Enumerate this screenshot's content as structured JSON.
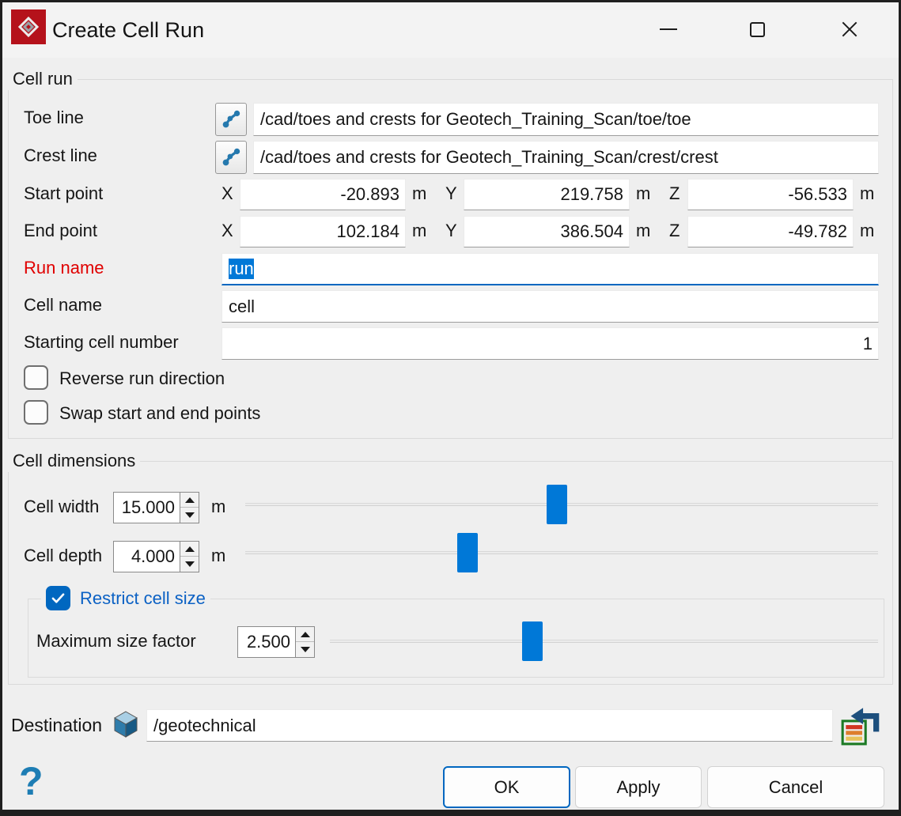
{
  "window": {
    "title": "Create Cell Run"
  },
  "icons": {
    "app_icon": "maptek-logo",
    "line_picker": "polyline",
    "destination_type": "cube",
    "destination_container": "container-with-arrow",
    "help": "question-mark"
  },
  "cell_run": {
    "group_label": "Cell run",
    "axis": {
      "x": "X",
      "y": "Y",
      "z": "Z"
    },
    "toe_line": {
      "label": "Toe line",
      "value": "/cad/toes and crests for Geotech_Training_Scan/toe/toe"
    },
    "crest_line": {
      "label": "Crest line",
      "value": "/cad/toes and crests for Geotech_Training_Scan/crest/crest"
    },
    "start_point": {
      "label": "Start point",
      "x": "-20.893",
      "y": "219.758",
      "z": "-56.533",
      "unit": "m"
    },
    "end_point": {
      "label": "End point",
      "x": "102.184",
      "y": "386.504",
      "z": "-49.782",
      "unit": "m"
    },
    "run_name": {
      "label": "Run name",
      "value": "run"
    },
    "cell_name": {
      "label": "Cell name",
      "value": "cell"
    },
    "starting_cell_number": {
      "label": "Starting cell number",
      "value": "1"
    },
    "reverse_run_direction": {
      "label": "Reverse run direction",
      "checked": false
    },
    "swap_start_end": {
      "label": "Swap start and end points",
      "checked": false
    }
  },
  "cell_dimensions": {
    "group_label": "Cell dimensions",
    "cell_width": {
      "label": "Cell width",
      "value": "15.000",
      "unit": "m"
    },
    "cell_depth": {
      "label": "Cell depth",
      "value": "4.000",
      "unit": "m"
    },
    "restrict_cell_size": {
      "label": "Restrict cell size",
      "checked": true
    },
    "maximum_size_factor": {
      "label": "Maximum size factor",
      "value": "2.500"
    }
  },
  "destination": {
    "label": "Destination",
    "value": "/geotechnical"
  },
  "footer": {
    "help_glyph": "?",
    "ok_label": "OK",
    "apply_label": "Apply",
    "cancel_label": "Cancel"
  },
  "colors": {
    "accent_blue": "#0078d7",
    "checkbox_blue": "#0067c0",
    "run_name_red": "#e00000",
    "restrict_label_blue": "#0b61c4",
    "logo_red": "#b5121b",
    "icon_blue": "#2579ae"
  }
}
